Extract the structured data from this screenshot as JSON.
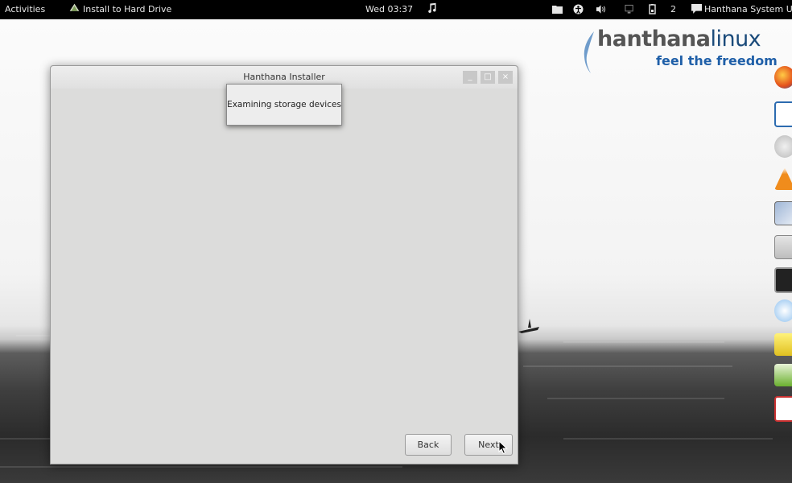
{
  "panel": {
    "activities": "Activities",
    "app_menu": "Install to Hard Drive",
    "clock": "Wed 03:37",
    "workspace_count": "2",
    "user": "Hanthana System User"
  },
  "brand": {
    "word_part1": "hanthana",
    "word_part2": "linux",
    "tagline": "feel the freedom"
  },
  "window": {
    "title": "Hanthana Installer",
    "minimize": "_",
    "maximize": "□",
    "close": "×"
  },
  "popup": {
    "text": "Examining storage devices"
  },
  "buttons": {
    "back": "Back",
    "next": "Next"
  },
  "icons": {
    "app_menu": "installer-icon",
    "music": "music-note-icon",
    "files": "folder-icon",
    "accessibility": "accessibility-icon",
    "volume": "volume-icon",
    "network": "network-icon",
    "battery": "battery-icon",
    "chat": "chat-icon"
  },
  "colors": {
    "panel": "#000000",
    "window": "#dcdcdb",
    "brand_blue": "#1f5fa8"
  }
}
